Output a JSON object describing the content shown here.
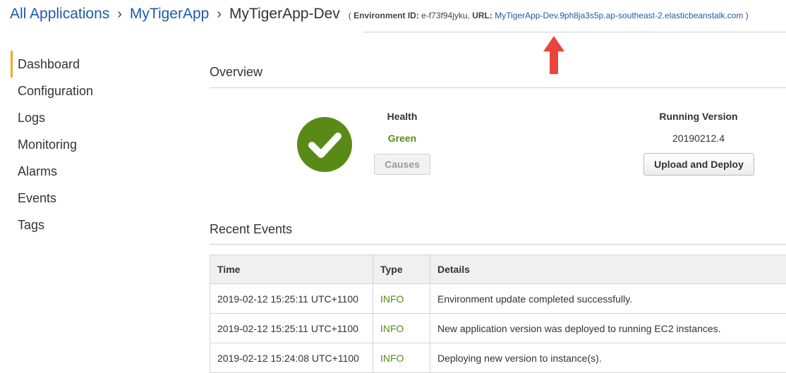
{
  "breadcrumb": {
    "all_applications": "All Applications",
    "app": "MyTigerApp",
    "environment": "MyTigerApp-Dev",
    "env_id_label": "Environment ID:",
    "env_id": "e-f73f94jyku",
    "url_label": "URL:",
    "url": "MyTigerApp-Dev.9ph8ja3s5p.ap-southeast-2.elasticbeanstalk.com"
  },
  "sidebar": {
    "items": [
      {
        "label": "Dashboard"
      },
      {
        "label": "Configuration"
      },
      {
        "label": "Logs"
      },
      {
        "label": "Monitoring"
      },
      {
        "label": "Alarms"
      },
      {
        "label": "Events"
      },
      {
        "label": "Tags"
      }
    ]
  },
  "overview": {
    "title": "Overview",
    "health_label": "Health",
    "health_value": "Green",
    "causes_button": "Causes",
    "running_version_label": "Running Version",
    "running_version": "20190212.4",
    "upload_deploy_button": "Upload and Deploy"
  },
  "recent_events": {
    "title": "Recent Events",
    "columns": [
      "Time",
      "Type",
      "Details"
    ],
    "rows": [
      {
        "time": "2019-02-12 15:25:11 UTC+1100",
        "type": "INFO",
        "details": "Environment update completed successfully."
      },
      {
        "time": "2019-02-12 15:25:11 UTC+1100",
        "type": "INFO",
        "details": "New application version was deployed to running EC2 instances."
      },
      {
        "time": "2019-02-12 15:24:08 UTC+1100",
        "type": "INFO",
        "details": "Deploying new version to instance(s)."
      }
    ]
  },
  "colors": {
    "link": "#1e5aa8",
    "health_green": "#5a8a16",
    "active_nav": "#f5a623",
    "annotation_arrow": "#e8463c"
  },
  "icons": {
    "health": "check-circle-icon",
    "annotation": "red-arrow-up-icon"
  }
}
